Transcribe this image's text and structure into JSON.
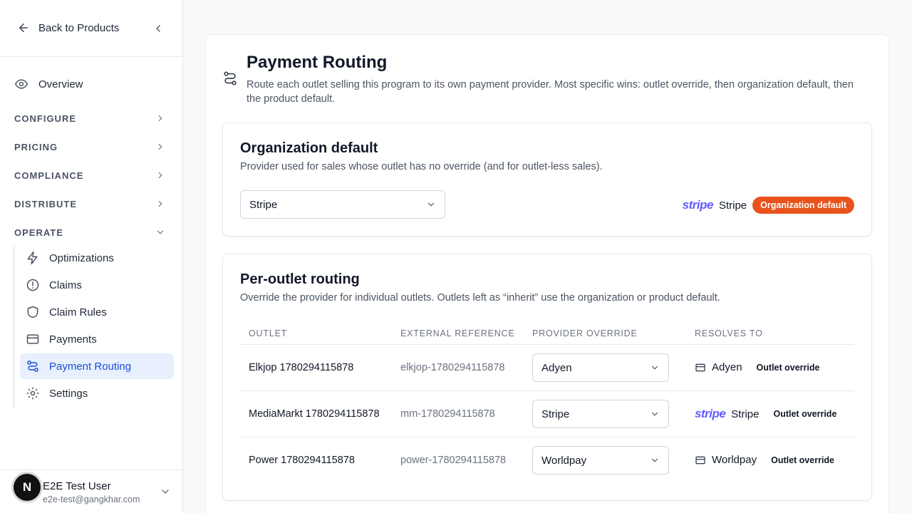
{
  "sidebar": {
    "back_label": "Back to Products",
    "overview_label": "Overview",
    "sections": [
      {
        "label": "CONFIGURE"
      },
      {
        "label": "PRICING"
      },
      {
        "label": "COMPLIANCE"
      },
      {
        "label": "DISTRIBUTE"
      },
      {
        "label": "OPERATE"
      }
    ],
    "operate_items": [
      {
        "label": "Optimizations",
        "icon": "bolt-icon"
      },
      {
        "label": "Claims",
        "icon": "alert-circle-icon"
      },
      {
        "label": "Claim Rules",
        "icon": "shield-icon"
      },
      {
        "label": "Payments",
        "icon": "credit-card-icon"
      },
      {
        "label": "Payment Routing",
        "icon": "route-icon",
        "active": true
      },
      {
        "label": "Settings",
        "icon": "gear-icon"
      }
    ],
    "user": {
      "avatar_initial": "N",
      "name": "E2E Test User",
      "email": "e2e-test@gangkhar.com"
    }
  },
  "page": {
    "title": "Payment Routing",
    "description": "Route each outlet selling this program to its own payment provider. Most specific wins: outlet override, then organization default, then the product default."
  },
  "org_default": {
    "title": "Organization default",
    "description": "Provider used for sales whose outlet has no override (and for outlet-less sales).",
    "selected": "Stripe",
    "resolved_logo": "stripe",
    "resolved_name": "Stripe",
    "badge": "Organization default",
    "badge_color": "#e8531c"
  },
  "per_outlet": {
    "title": "Per-outlet routing",
    "description": "Override the provider for individual outlets. Outlets left as “inherit” use the organization or product default.",
    "columns": [
      "OUTLET",
      "EXTERNAL REFERENCE",
      "PROVIDER OVERRIDE",
      "RESOLVES TO"
    ],
    "rows": [
      {
        "outlet": "Elkjop 1780294115878",
        "ref": "elkjop-1780294115878",
        "override": "Adyen",
        "resolves": "Adyen",
        "source": "Outlet override"
      },
      {
        "outlet": "MediaMarkt 1780294115878",
        "ref": "mm-1780294115878",
        "override": "Stripe",
        "resolves_logo": "stripe",
        "resolves": "Stripe",
        "source": "Outlet override"
      },
      {
        "outlet": "Power 1780294115878",
        "ref": "power-1780294115878",
        "override": "Worldpay",
        "resolves": "Worldpay",
        "source": "Outlet override"
      }
    ]
  },
  "colors": {
    "accent": "#1d4ed8",
    "active_bg": "#e8f0fe",
    "stripe": "#635bff"
  }
}
